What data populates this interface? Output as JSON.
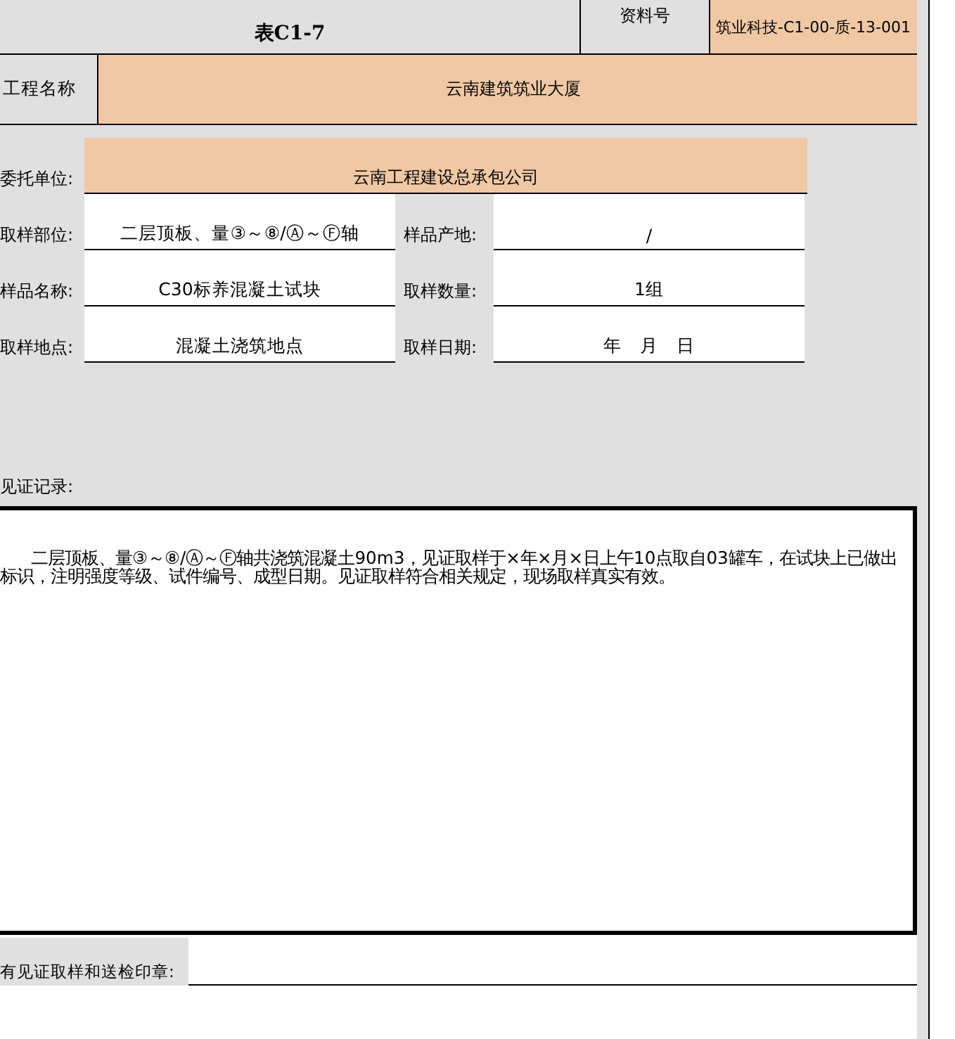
{
  "header": {
    "form_number": "表C1-7",
    "doc_no_label": "资料号",
    "doc_no": "筑业科技-C1-00-质-13-001"
  },
  "project": {
    "label": "工程名称",
    "value": "云南建筑筑业大厦"
  },
  "client": {
    "label": "委托单位:",
    "value": "云南工程建设总承包公司"
  },
  "fields": [
    {
      "label": "取样部位:",
      "value": "二层顶板、量③～⑧/Ⓐ～Ⓕ轴",
      "label2": "样品产地:",
      "value2": "/"
    },
    {
      "label": "样品名称:",
      "value": "C30标养混凝土试块",
      "label2": "取样数量:",
      "value2": "1组"
    },
    {
      "label": "取样地点:",
      "value": "混凝土浇筑地点",
      "label2": "取样日期:",
      "value2": "年　月　日"
    }
  ],
  "record": {
    "label": "见证记录:",
    "text": "二层顶板、量③～⑧/Ⓐ～Ⓕ轴共浇筑混凝土90m3，见证取样于×年×月×日上午10点取自03罐车，在试块上已做出标识，注明强度等级、试件编号、成型日期。见证取样符合相关规定，现场取样真实有效。"
  },
  "seal": {
    "label": "有见证取样和送检印章:"
  }
}
